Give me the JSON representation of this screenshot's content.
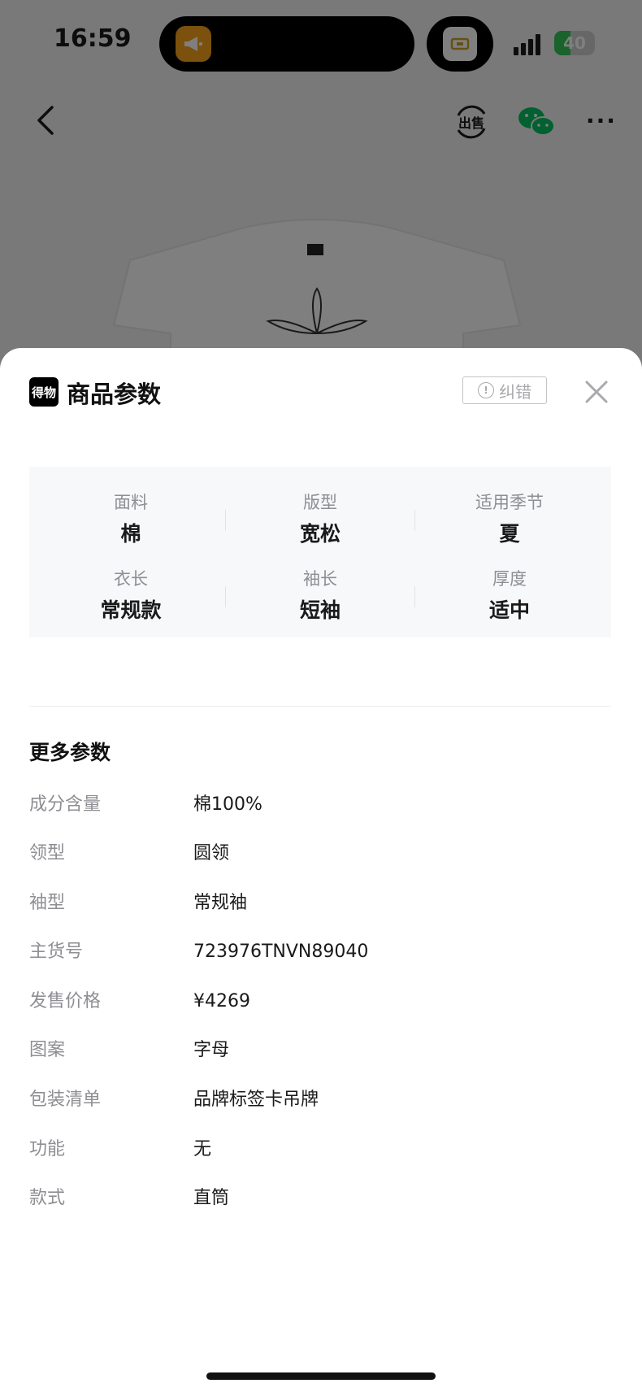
{
  "status_bar": {
    "time": "16:59",
    "battery": "40",
    "battery_level_percent": 40
  },
  "nav": {
    "back_icon": "chevron-left-icon",
    "sell_icon": "sell-icon",
    "sell_label": "出售",
    "wechat_icon": "wechat-icon",
    "more_icon": "more-icon",
    "more_label": "···"
  },
  "sheet": {
    "brand_logo": "得物",
    "title": "商品参数",
    "report_label": "纠错",
    "report_icon_glyph": "!",
    "close_icon": "close-icon"
  },
  "key_params": [
    {
      "label": "面料",
      "value": "棉"
    },
    {
      "label": "版型",
      "value": "宽松"
    },
    {
      "label": "适用季节",
      "value": "夏"
    },
    {
      "label": "衣长",
      "value": "常规款"
    },
    {
      "label": "袖长",
      "value": "短袖"
    },
    {
      "label": "厚度",
      "value": "适中"
    }
  ],
  "more_params": {
    "title": "更多参数",
    "rows": [
      {
        "label": "成分含量",
        "value": "棉100%"
      },
      {
        "label": "领型",
        "value": "圆领"
      },
      {
        "label": "袖型",
        "value": "常规袖"
      },
      {
        "label": "主货号",
        "value": "723976TNVN89040"
      },
      {
        "label": "发售价格",
        "value": "¥4269"
      },
      {
        "label": "图案",
        "value": "字母"
      },
      {
        "label": "包装清单",
        "value": "品牌标签卡吊牌"
      },
      {
        "label": "功能",
        "value": "无"
      },
      {
        "label": "款式",
        "value": "直筒"
      }
    ]
  },
  "colors": {
    "overlay": "#000000",
    "sheet_background": "#ffffff",
    "params_background": "#f7f8fa",
    "label_gray": "#8e8e93",
    "text_dark": "#1a1a1a",
    "island_app_orange": "#f7a21a",
    "battery_green": "#34c759",
    "wechat_green": "#07c160"
  }
}
